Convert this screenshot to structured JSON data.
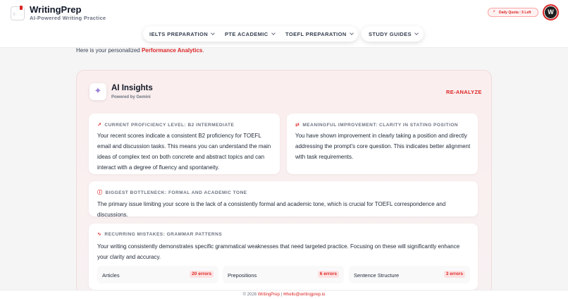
{
  "header": {
    "brand": "WritingPrep",
    "tagline": "AI-Powered Writing Practice",
    "quota": "Daily Quota : 5 Left",
    "avatar_initial": "W"
  },
  "nav": {
    "items": [
      {
        "label": "IELTS PREPARATION",
        "icon": "chevron-down-icon"
      },
      {
        "label": "PTE ACADEMIC",
        "icon": "chevron-down-icon"
      },
      {
        "label": "TOEFL PREPARATION",
        "icon": "chevron-down-icon"
      },
      {
        "label": "STUDY GUIDES",
        "icon": "chevron-down-icon"
      }
    ]
  },
  "intro": {
    "prefix": "Here is your personalized ",
    "highlight": "Performance Analytics",
    "suffix": "."
  },
  "insights": {
    "title": "AI Insights",
    "subtitle": "Powered by Gemini",
    "reanalyze": "RE-ANALYZE",
    "proficiency": {
      "heading": "CURRENT PROFICIENCY LEVEL: B2 INTERMEDIATE",
      "body": "Your recent scores indicate a consistent B2 proficiency for TOEFL email and discussion tasks. This means you can understand the main ideas of complex text on both concrete and abstract topics and can interact with a degree of fluency and spontaneity."
    },
    "improvement": {
      "heading": "MEANINGFUL IMPROVEMENT: CLARITY IN STATING POSITION",
      "body": "You have shown improvement in clearly taking a position and directly addressing the prompt's core question. This indicates better alignment with task requirements."
    },
    "bottleneck": {
      "heading": "BIGGEST BOTTLENECK: FORMAL AND ACADEMIC TONE",
      "body": "The primary issue limiting your score is the lack of a consistently formal and academic tone, which is crucial for TOEFL correspondence and discussions."
    },
    "mistakes": {
      "heading": "RECURRING MISTAKES: GRAMMAR PATTERNS",
      "body": "Your writing consistently demonstrates specific grammatical weaknesses that need targeted practice. Focusing on these will significantly enhance your clarity and accuracy.",
      "items": [
        {
          "label": "Articles",
          "count": "20 errors"
        },
        {
          "label": "Prepositions",
          "count": "6 errors"
        },
        {
          "label": "Sentence Structure",
          "count": "3 errors"
        }
      ]
    }
  },
  "footer": {
    "copyright": "© 2026",
    "brand": "WritingPrep",
    "separator": "|",
    "email": "hello@writingprep.io"
  },
  "colors": {
    "accent": "#dc2626",
    "panel": "#fbeeee",
    "sparkle": "#9b7fd6"
  }
}
